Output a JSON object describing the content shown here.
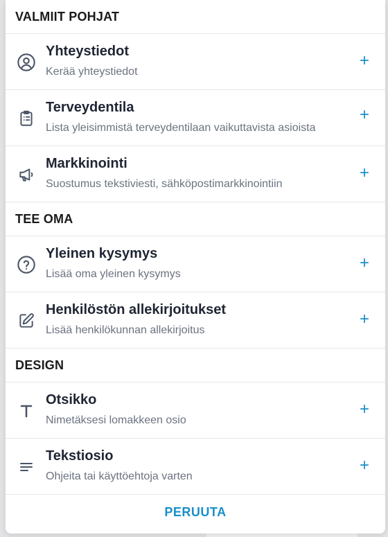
{
  "sections": [
    {
      "title": "VALMIIT POHJAT",
      "items": [
        {
          "title": "Yhteystiedot",
          "subtitle": "Kerää yhteystiedot",
          "icon": "user-circle-icon"
        },
        {
          "title": "Terveydentila",
          "subtitle": "Lista yleisimmistä terveydentilaan vaikuttavista asioista",
          "icon": "clipboard-list-icon"
        },
        {
          "title": "Markkinointi",
          "subtitle": "Suostumus tekstiviesti, sähköpostimarkkinointiin",
          "icon": "megaphone-icon"
        }
      ]
    },
    {
      "title": "TEE OMA",
      "items": [
        {
          "title": "Yleinen kysymys",
          "subtitle": "Lisää oma yleinen kysymys",
          "icon": "question-circle-icon"
        },
        {
          "title": "Henkilöstön allekirjoitukset",
          "subtitle": "Lisää henkilökunnan allekirjoitus",
          "icon": "edit-icon"
        }
      ]
    },
    {
      "title": "DESIGN",
      "items": [
        {
          "title": "Otsikko",
          "subtitle": "Nimetäksesi lomakkeen osio",
          "icon": "heading-t-icon"
        },
        {
          "title": "Tekstiosio",
          "subtitle": "Ohjeita tai käyttöehtoja varten",
          "icon": "text-lines-icon"
        }
      ]
    }
  ],
  "plus_symbol": "+",
  "cancel_label": "PERUUTA",
  "colors": {
    "accent": "#1a8fc9",
    "title": "#1f2533",
    "subtitle": "#6b7280",
    "icon": "#4a5566"
  }
}
